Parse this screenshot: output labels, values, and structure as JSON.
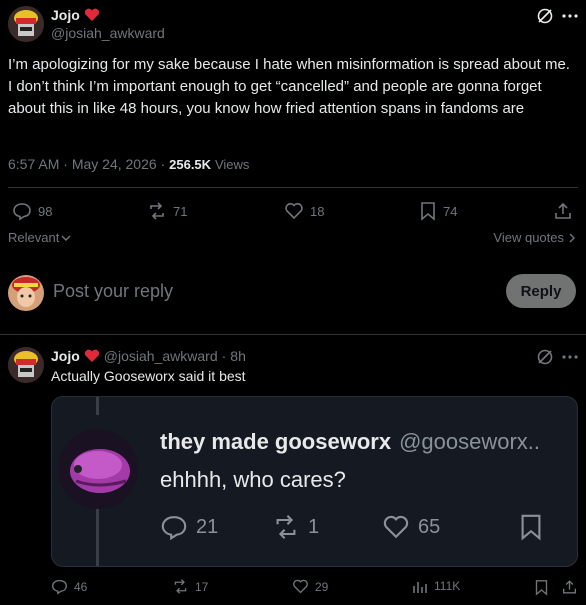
{
  "main_post": {
    "author_name": "Jojo",
    "author_handle": "@josiah_awkward",
    "text": "I’m apologizing for my sake because I hate when misinformation is spread about me. I don’t think I’m important enough to get “cancelled” and people are gonna forget about this in like 48 hours, you know how fried attention spans in fandoms are",
    "time": "6:57 AM",
    "date": "May 24, 2026",
    "views_count": "256.5K",
    "views_label": "Views",
    "replies": "98",
    "reposts": "71",
    "likes": "18",
    "bookmarks": "74",
    "relevant_label": "Relevant",
    "view_quotes_label": "View quotes"
  },
  "composer": {
    "placeholder": "Post your reply",
    "reply_button": "Reply"
  },
  "reply_post": {
    "author_name": "Jojo",
    "author_handle": "@josiah_awkward",
    "age": "8h",
    "text": "Actually Gooseworx said it best",
    "replies": "46",
    "reposts": "17",
    "likes": "29",
    "views": "111K"
  },
  "embedded_screenshot": {
    "display_name": "they made gooseworx",
    "handle": "@gooseworx..",
    "text": "ehhhh, who cares?",
    "replies": "21",
    "reposts": "1",
    "likes": "65"
  },
  "colors": {
    "heart": "#f91880",
    "muted": "#71767b",
    "divider": "#2f3336"
  }
}
